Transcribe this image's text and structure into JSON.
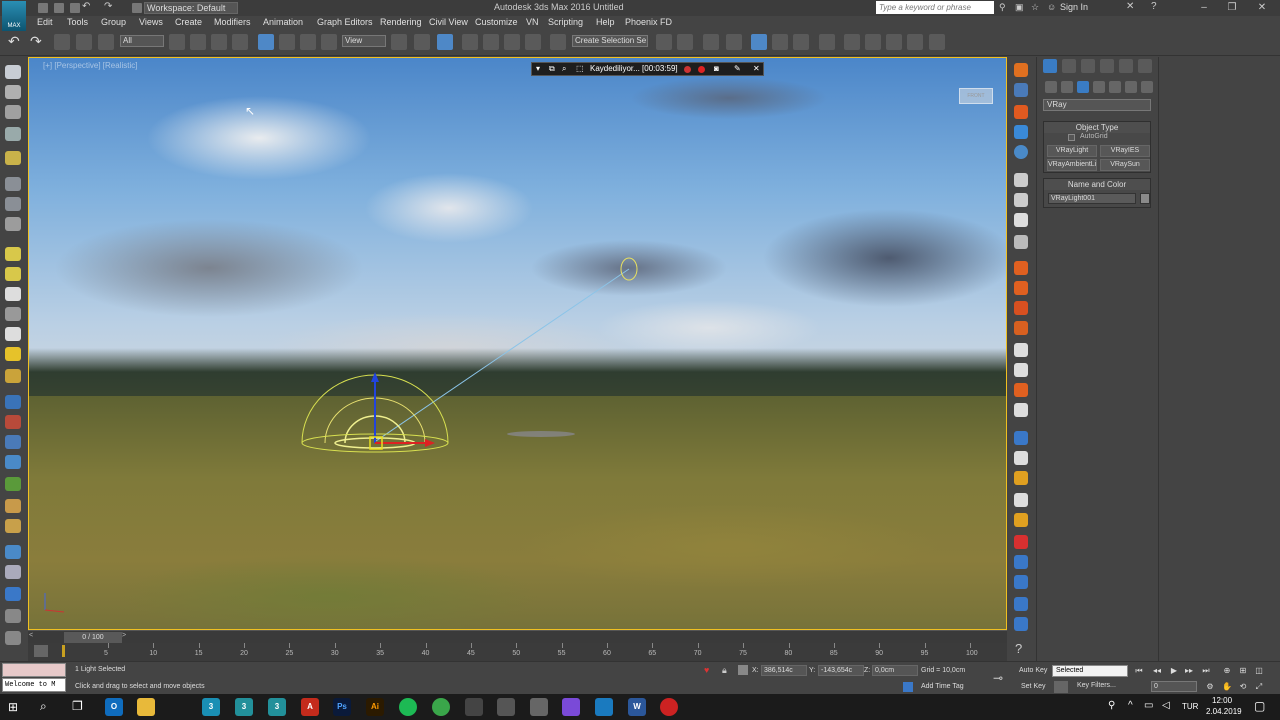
{
  "titlebar": {
    "workspace": "Workspace: Default",
    "title": "Autodesk 3ds Max 2016     Untitled",
    "search_placeholder": "Type a keyword or phrase",
    "signin": "Sign In",
    "logo_text": "MAX"
  },
  "menu": [
    "Edit",
    "Tools",
    "Group",
    "Views",
    "Create",
    "Modifiers",
    "Animation",
    "Graph Editors",
    "Rendering",
    "Civil View",
    "Customize",
    "VN",
    "Scripting",
    "Help",
    "Phoenix FD"
  ],
  "toolbar": {
    "filter_value": "All",
    "refcoord_value": "View",
    "selection_set": "Create Selection Se"
  },
  "viewport": {
    "label": "[+] [Perspective] [Realistic]",
    "viewcube_label": "FRONT"
  },
  "recording": {
    "text": "Kaydediliyor... [00:03:59]"
  },
  "command_panel": {
    "renderer_select": "VRay",
    "object_type_title": "Object Type",
    "autogrid_label": "AutoGrid",
    "buttons": [
      "VRayLight",
      "VRayIES",
      "VRayAmbientLight",
      "VRaySun"
    ],
    "name_color_title": "Name and Color",
    "object_name": "VRayLight001"
  },
  "timeline": {
    "frame_display": "0 / 100",
    "ticks": [
      "5",
      "10",
      "15",
      "20",
      "25",
      "30",
      "35",
      "40",
      "45",
      "50",
      "55",
      "60",
      "65",
      "70",
      "75",
      "80",
      "85",
      "90",
      "95",
      "100"
    ]
  },
  "status": {
    "maxscript_output": "Welcome to M",
    "selection": "1 Light Selected",
    "prompt": "Click and drag to select and move objects",
    "x_label": "X:",
    "x_value": "386,514c",
    "y_label": "Y:",
    "y_value": "-143,654c",
    "z_label": "Z:",
    "z_value": "0,0cm",
    "grid": "Grid = 10,0cm",
    "add_time_tag": "Add Time Tag",
    "auto_key": "Auto Key",
    "set_key": "Set Key",
    "selected_drop": "Selected",
    "key_filters": "Key Filters...",
    "frame_value": "0"
  },
  "taskbar": {
    "language": "TUR",
    "time": "12:00",
    "date": "2.04.2019"
  }
}
